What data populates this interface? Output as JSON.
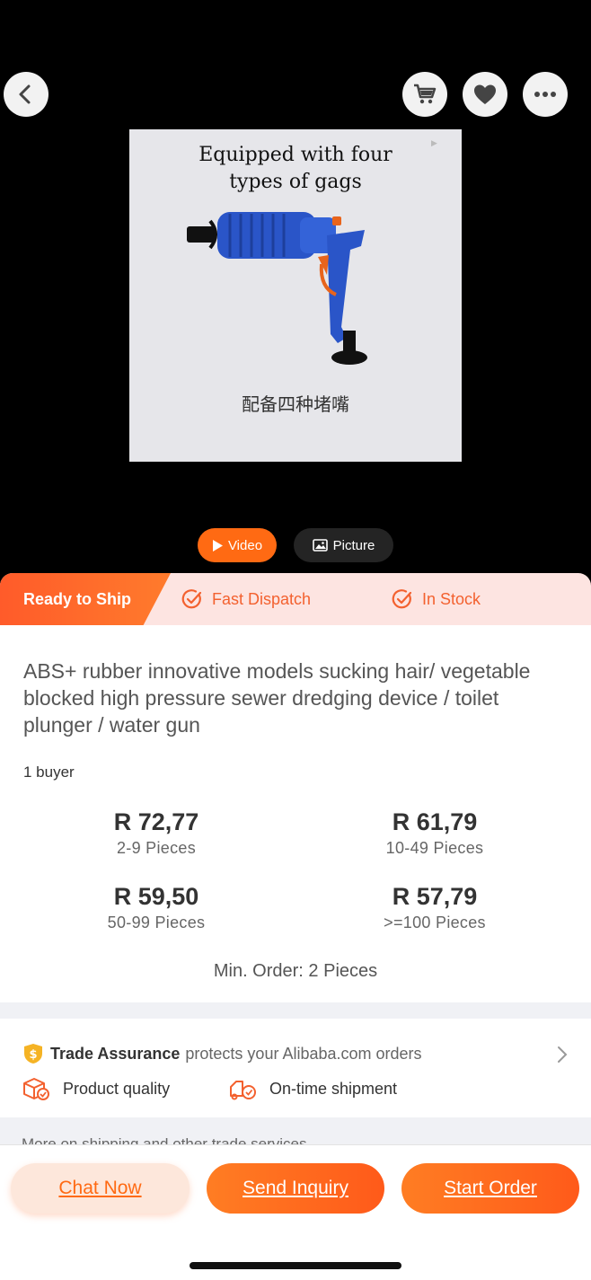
{
  "media": {
    "caption_en_line1": "Equipped with four",
    "caption_en_line2": "types of gags",
    "caption_zh": "配备四种堵嘴",
    "video_tab": "Video",
    "picture_tab": "Picture",
    "icons": {
      "back": "chevron-left-icon",
      "cart": "cart-icon",
      "favorite": "heart-icon",
      "more": "more-dots-icon"
    }
  },
  "shipping": {
    "ready_label": "Ready to Ship",
    "fast_dispatch": "Fast Dispatch",
    "in_stock": "In Stock"
  },
  "product": {
    "title": "ABS+ rubber innovative models sucking hair/ vegetable blocked high pressure sewer dredging device / toilet plunger / water gun",
    "buyers": "1 buyer",
    "tiers": [
      {
        "price": "R 72,77",
        "qty": "2-9 Pieces"
      },
      {
        "price": "R 61,79",
        "qty": "10-49 Pieces"
      },
      {
        "price": "R 59,50",
        "qty": "50-99 Pieces"
      },
      {
        "price": "R 57,79",
        "qty": ">=100 Pieces"
      }
    ],
    "min_order": "Min. Order: 2 Pieces"
  },
  "trade_assurance": {
    "title": "Trade Assurance",
    "text": "protects your Alibaba.com orders",
    "feature_quality": "Product quality",
    "feature_shipment": "On-time shipment",
    "more_text": "More on shipping and other trade services"
  },
  "actions": {
    "chat": "Chat Now",
    "inquiry": "Send Inquiry",
    "order": "Start Order"
  },
  "colors": {
    "accent": "#ff6a13",
    "strip_bg": "#fde4e1",
    "product_blue": "#2a55c8"
  }
}
